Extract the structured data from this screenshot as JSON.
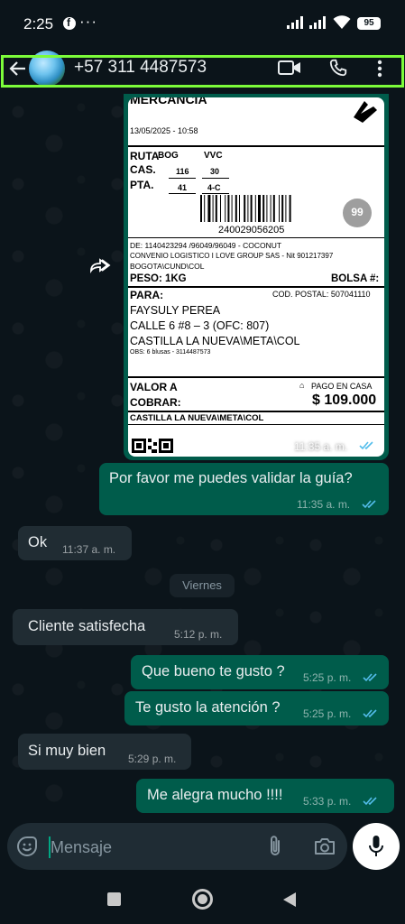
{
  "status_bar": {
    "time": "2:25",
    "dots": "···",
    "battery": "95"
  },
  "header": {
    "contact": "+57 311 4487573"
  },
  "shipping_label": {
    "top_cut": "MERCANCIA",
    "date": "13/05/2025 - 10:58",
    "route_label": "RUTA",
    "route_from": "BOG",
    "route_to": "VVC",
    "cas_label": "CAS.",
    "cas_from": "116",
    "cas_to": "30",
    "pta_label": "PTA.",
    "pta_from": "41",
    "pta_to": "4-C",
    "barcode_number": "240029056205",
    "badge": "99",
    "from_line": "DE: 1140423294 /96049/96049 - COCONUT",
    "agreement_line": "CONVENIO LOGISTICO I LOVE GROUP SAS - Nit 901217397",
    "origin": "BOGOTA\\CUND\\COL",
    "weight": "PESO: 1KG",
    "bag": "BOLSA #:",
    "to_label": "PARA:",
    "postal": "COD. POSTAL: 507041110",
    "recipient": "FAYSULY PEREA",
    "address": "CALLE 6 #8 – 3 (OFC: 807)",
    "destination": "CASTILLA LA NUEVA\\META\\COL",
    "obs": "OBS: 6 blusas - 3114487573",
    "value_label_1": "VALOR A",
    "value_label_2": "COBRAR:",
    "pay_mode": "PAGO EN CASA",
    "amount": "$ 109.000",
    "footer_city": "CASTILLA LA NUEVA\\META\\COL"
  },
  "messages": [
    {
      "side": "out",
      "text": "",
      "time": "11:35 a. m."
    },
    {
      "side": "out",
      "text": "Por favor me puedes validar la guía?",
      "time": "11:35 a. m."
    },
    {
      "side": "in",
      "text": "Ok",
      "time": "11:37 a. m."
    },
    {
      "side": "in",
      "text": "Cliente satisfecha",
      "time": "5:12 p. m."
    },
    {
      "side": "out",
      "text": "Que bueno te gusto ?",
      "time": "5:25 p. m."
    },
    {
      "side": "out",
      "text": "Te gusto la atención ?",
      "time": "5:25 p. m."
    },
    {
      "side": "in",
      "text": "Si muy bien",
      "time": "5:29 p. m."
    },
    {
      "side": "out",
      "text": "Me alegra mucho !!!!",
      "time": "5:33 p. m."
    }
  ],
  "date_separator": "Viernes",
  "composer": {
    "placeholder": "Mensaje"
  },
  "icons": [
    "back-icon",
    "video-call-icon",
    "voice-call-icon",
    "menu-icon",
    "forward-icon",
    "emoji-icon",
    "attach-icon",
    "camera-icon",
    "mic-icon",
    "read-ticks-icon"
  ],
  "colors": {
    "outgoing": "#005c4b",
    "incoming": "#202c33",
    "background": "#0b141a",
    "read_ticks": "#53bdeb",
    "highlight_outline": "#7cfc3a"
  }
}
